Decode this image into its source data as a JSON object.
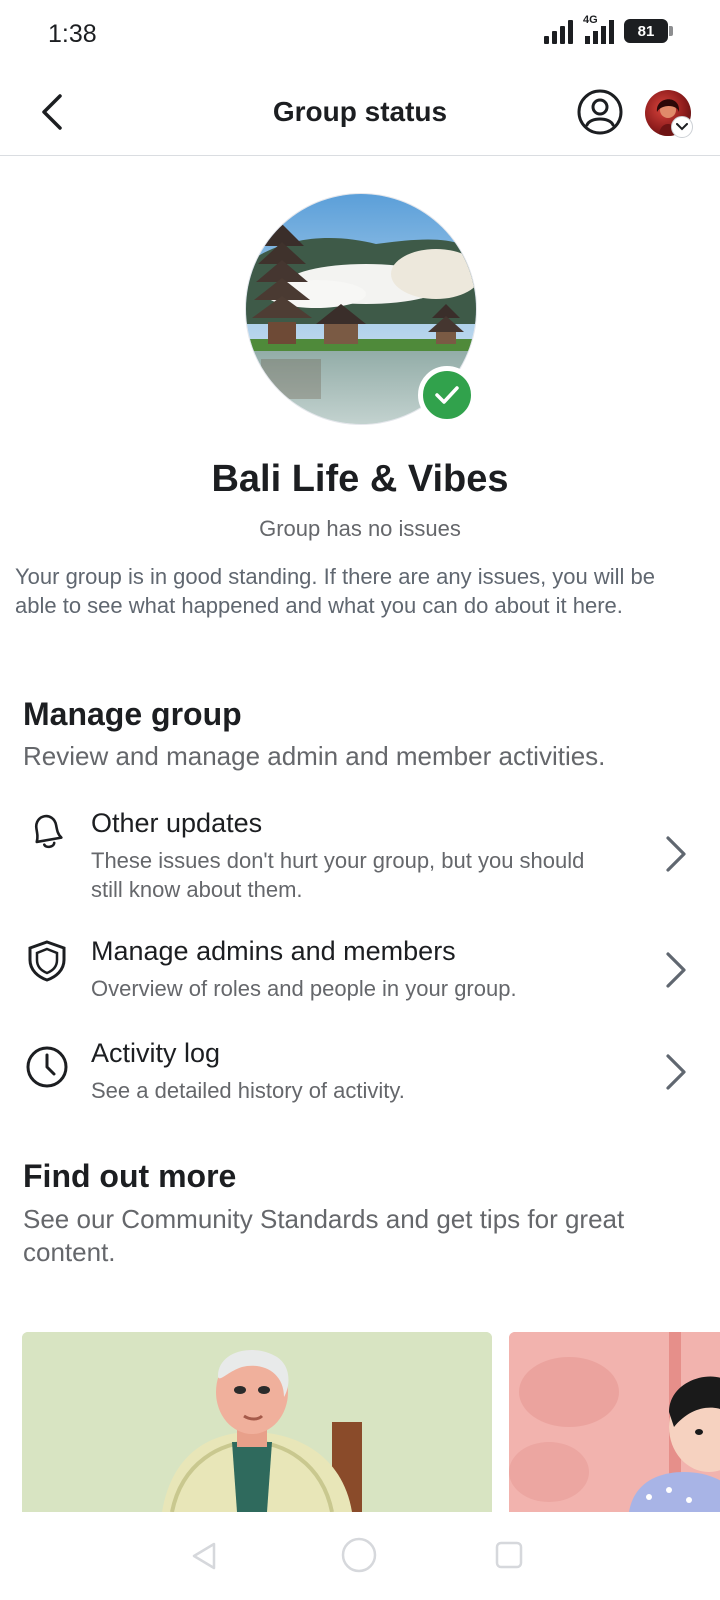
{
  "status_bar": {
    "time": "1:38",
    "network": "4G",
    "battery": "81"
  },
  "header": {
    "title": "Group status"
  },
  "group": {
    "name": "Bali Life & Vibes",
    "status": "Group has no issues",
    "description": "Your group is in good standing. If there are any issues, you will be able to see what happened and what you can do about it here.",
    "status_color": "#31a24c"
  },
  "manage": {
    "title": "Manage group",
    "subtitle": "Review and manage admin and member activities.",
    "items": [
      {
        "title": "Other updates",
        "subtitle": "These issues don't hurt your group, but you should still know about them.",
        "icon": "bell-icon"
      },
      {
        "title": "Manage admins and members",
        "subtitle": "Overview of roles and people in your group.",
        "icon": "shield-icon"
      },
      {
        "title": "Activity log",
        "subtitle": "See a detailed history of activity.",
        "icon": "clock-icon"
      }
    ]
  },
  "find_out": {
    "title": "Find out more",
    "subtitle": "See our Community Standards and get tips for great content."
  }
}
